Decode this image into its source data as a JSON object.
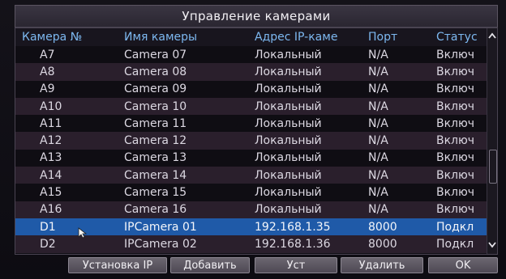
{
  "window": {
    "title": "Управление камерами"
  },
  "table": {
    "headers": [
      "Камера №",
      "Имя камеры",
      "Адрес IP-каме",
      "Порт",
      "Статус"
    ],
    "rows": [
      {
        "cam": "A7",
        "name": "Camera 07",
        "ip": "Локальный",
        "port": "N/A",
        "status": "Включ"
      },
      {
        "cam": "A8",
        "name": "Camera 08",
        "ip": "Локальный",
        "port": "N/A",
        "status": "Включ"
      },
      {
        "cam": "A9",
        "name": "Camera 09",
        "ip": "Локальный",
        "port": "N/A",
        "status": "Включ"
      },
      {
        "cam": "A10",
        "name": "Camera 10",
        "ip": "Локальный",
        "port": "N/A",
        "status": "Включ"
      },
      {
        "cam": "A11",
        "name": "Camera 11",
        "ip": "Локальный",
        "port": "N/A",
        "status": "Включ"
      },
      {
        "cam": "A12",
        "name": "Camera 12",
        "ip": "Локальный",
        "port": "N/A",
        "status": "Включ"
      },
      {
        "cam": "A13",
        "name": "Camera 13",
        "ip": "Локальный",
        "port": "N/A",
        "status": "Включ"
      },
      {
        "cam": "A14",
        "name": "Camera 14",
        "ip": "Локальный",
        "port": "N/A",
        "status": "Включ"
      },
      {
        "cam": "A15",
        "name": "Camera 15",
        "ip": "Локальный",
        "port": "N/A",
        "status": "Включ"
      },
      {
        "cam": "A16",
        "name": "Camera 16",
        "ip": "Локальный",
        "port": "N/A",
        "status": "Включ"
      },
      {
        "cam": "D1",
        "name": "IPCamera 01",
        "ip": "192.168.1.35",
        "port": "8000",
        "status": "Подкл"
      },
      {
        "cam": "D2",
        "name": "IPCamera 02",
        "ip": "192.168.1.36",
        "port": "8000",
        "status": "Подкл"
      }
    ],
    "selected_row_index": 10
  },
  "scrollbar": {
    "up_icon": "chevron-up-icon",
    "down_icon": "chevron-down-icon"
  },
  "buttons": {
    "setup_ip": "Установка IP",
    "add": "Добавить",
    "set": "Уст",
    "delete": "Удалить",
    "ok": "OK"
  },
  "colors": {
    "header_text": "#7db8f0",
    "selected_row": "#1f5aa8",
    "row_dark": "#0f0d13",
    "row_purple": "#2a1f2c"
  }
}
